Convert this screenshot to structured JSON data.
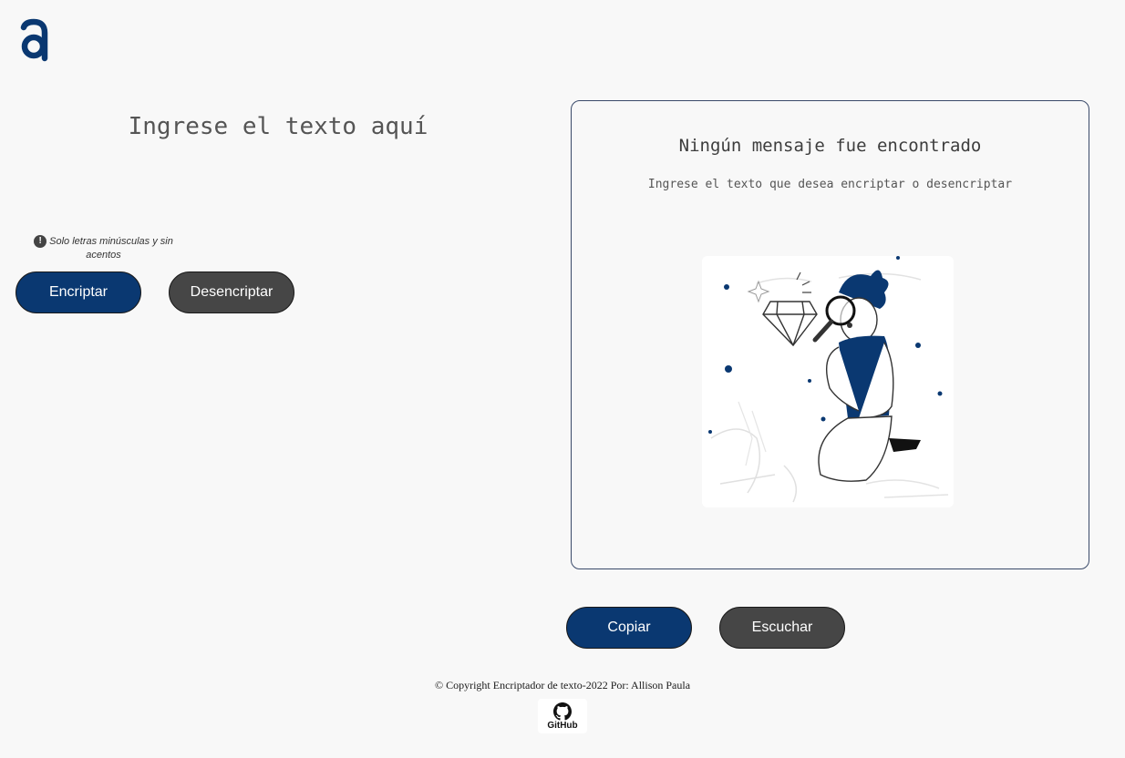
{
  "brand": {
    "logo_letter": "a",
    "color": "#0a3871"
  },
  "input": {
    "placeholder": "Ingrese el texto aquí",
    "value": ""
  },
  "hint": {
    "icon": "exclamation-circle-icon",
    "text": "Solo letras minúsculas y sin acentos"
  },
  "actions": {
    "encrypt_label": "Encriptar",
    "decrypt_label": "Desencriptar"
  },
  "output": {
    "title": "Ningún mensaje fue encontrado",
    "subtitle": "Ingrese el texto que desea encriptar o desencriptar",
    "illustration": "person-with-magnifying-glass-illustration"
  },
  "output_actions": {
    "copy_label": "Copiar",
    "listen_label": "Escuchar"
  },
  "footer": {
    "copyright": "© Copyright Encriptador de texto-2022 Por: Allison Paula",
    "github_label": "GitHub",
    "github_icon": "github-icon"
  },
  "colors": {
    "primary": "#0a3871",
    "secondary": "#464646",
    "background": "#f8f8f8"
  }
}
